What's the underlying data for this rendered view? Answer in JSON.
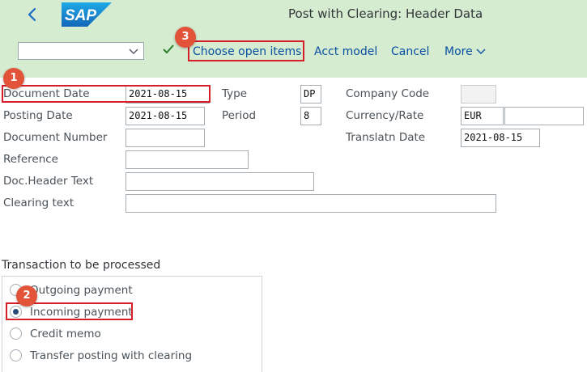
{
  "header": {
    "title": "Post with Clearing: Header Data",
    "logo_text": "SAP"
  },
  "toolbar": {
    "command_field_value": "",
    "buttons": [
      "Choose open items",
      "Acct model",
      "Cancel",
      "More"
    ]
  },
  "form": {
    "document_date": {
      "label": "Document Date",
      "value": "2021-08-15"
    },
    "posting_date": {
      "label": "Posting Date",
      "value": "2021-08-15"
    },
    "document_number": {
      "label": "Document Number",
      "value": ""
    },
    "reference": {
      "label": "Reference",
      "value": ""
    },
    "doc_header_text": {
      "label": "Doc.Header Text",
      "value": ""
    },
    "clearing_text": {
      "label": "Clearing text",
      "value": ""
    },
    "type": {
      "label": "Type",
      "value": "DP"
    },
    "period": {
      "label": "Period",
      "value": "8"
    },
    "company_code": {
      "label": "Company Code",
      "value": ""
    },
    "currency_rate": {
      "label": "Currency/Rate",
      "currency": "EUR",
      "rate": ""
    },
    "translatn_date": {
      "label": "Translatn Date",
      "value": "2021-08-15"
    }
  },
  "transaction": {
    "title": "Transaction to be processed",
    "options": [
      "Outgoing payment",
      "Incoming payment",
      "Credit memo",
      "Transfer posting with clearing"
    ],
    "selected": "Incoming payment"
  },
  "annotations": {
    "step1": "1",
    "step2": "2",
    "step3": "3",
    "highlight_color": "#d71d29",
    "badge_color": "#e2533a"
  },
  "colors": {
    "header_bg": "#d5ecd0",
    "link": "#0a4fa3",
    "logo_blue": "#1e86d0"
  }
}
